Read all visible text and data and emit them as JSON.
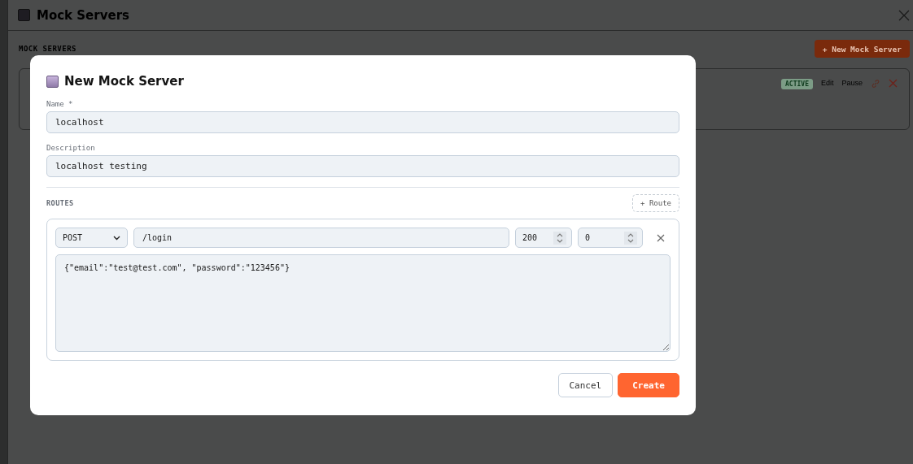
{
  "window": {
    "title": "Mock Servers"
  },
  "page": {
    "section_label": "MOCK SERVERS",
    "new_button": "+ New Mock Server",
    "servers": [
      {
        "status": "ACTIVE",
        "actions": [
          "Edit",
          "Pause"
        ]
      }
    ]
  },
  "dialog": {
    "title": "New Mock Server",
    "fields": [
      {
        "label": "Name *",
        "value": "localhost"
      },
      {
        "label": "Description",
        "value": "localhost testing"
      }
    ],
    "routes_label": "ROUTES",
    "add_route_button": "+ Route",
    "routes": [
      {
        "method": "POST",
        "path": "/login",
        "status_code": "200",
        "delay": "0",
        "body": "{\"email\":\"test@test.com\", \"password\":\"123456\"}"
      }
    ],
    "buttons": [
      {
        "label": "Cancel",
        "kind": "secondary"
      },
      {
        "label": "Create",
        "kind": "primary"
      }
    ]
  }
}
